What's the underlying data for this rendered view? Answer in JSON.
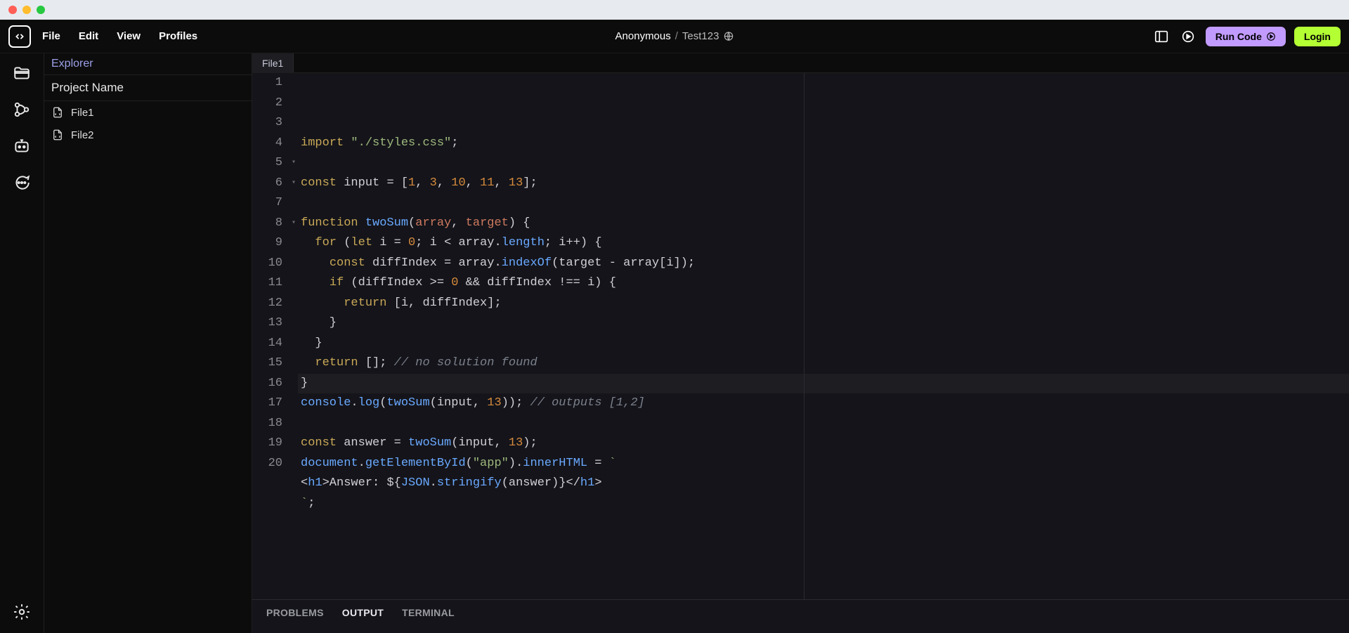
{
  "menu": {
    "file": "File",
    "edit": "Edit",
    "view": "View",
    "profiles": "Profiles"
  },
  "breadcrumb": {
    "owner": "Anonymous",
    "slash": "/",
    "project": "Test123"
  },
  "actions": {
    "run_code": "Run Code",
    "login": "Login"
  },
  "explorer": {
    "title": "Explorer",
    "project_name": "Project Name",
    "files": [
      "File1",
      "File2"
    ]
  },
  "tabs": {
    "active": "File1"
  },
  "bottom_tabs": {
    "problems": "PROBLEMS",
    "output": "OUTPUT",
    "terminal": "TERMINAL"
  },
  "gutter_count": 20,
  "code_lines": [
    [
      [
        "kw",
        "import"
      ],
      [
        "punct",
        " "
      ],
      [
        "str",
        "\"./styles.css\""
      ],
      [
        "punct",
        ";"
      ]
    ],
    [],
    [
      [
        "kw",
        "const"
      ],
      [
        "punct",
        " input "
      ],
      [
        "punct",
        "= ["
      ],
      [
        "num",
        "1"
      ],
      [
        "punct",
        ", "
      ],
      [
        "num",
        "3"
      ],
      [
        "punct",
        ", "
      ],
      [
        "num",
        "10"
      ],
      [
        "punct",
        ", "
      ],
      [
        "num",
        "11"
      ],
      [
        "punct",
        ", "
      ],
      [
        "num",
        "13"
      ],
      [
        "punct",
        "];"
      ]
    ],
    [],
    [
      [
        "kw",
        "function"
      ],
      [
        "punct",
        " "
      ],
      [
        "fn",
        "twoSum"
      ],
      [
        "punct",
        "("
      ],
      [
        "param",
        "array"
      ],
      [
        "punct",
        ", "
      ],
      [
        "param",
        "target"
      ],
      [
        "punct",
        ") {"
      ]
    ],
    [
      [
        "punct",
        "  "
      ],
      [
        "kw",
        "for"
      ],
      [
        "punct",
        " ("
      ],
      [
        "kw",
        "let"
      ],
      [
        "punct",
        " i "
      ],
      [
        "punct",
        "= "
      ],
      [
        "num",
        "0"
      ],
      [
        "punct",
        "; i "
      ],
      [
        "punct",
        "< "
      ],
      [
        "punct",
        "array."
      ],
      [
        "prop",
        "length"
      ],
      [
        "punct",
        "; i++) {"
      ]
    ],
    [
      [
        "punct",
        "    "
      ],
      [
        "kw",
        "const"
      ],
      [
        "punct",
        " diffIndex "
      ],
      [
        "punct",
        "= array."
      ],
      [
        "fn",
        "indexOf"
      ],
      [
        "punct",
        "(target "
      ],
      [
        "punct",
        "- array[i]);"
      ]
    ],
    [
      [
        "punct",
        "    "
      ],
      [
        "kw",
        "if"
      ],
      [
        "punct",
        " (diffIndex "
      ],
      [
        "punct",
        ">= "
      ],
      [
        "num",
        "0"
      ],
      [
        "punct",
        " "
      ],
      [
        "punct",
        "&& diffIndex "
      ],
      [
        "punct",
        "!== i) {"
      ]
    ],
    [
      [
        "punct",
        "      "
      ],
      [
        "kw",
        "return"
      ],
      [
        "punct",
        " [i, diffIndex];"
      ]
    ],
    [
      [
        "punct",
        "    }"
      ]
    ],
    [
      [
        "punct",
        "  }"
      ]
    ],
    [
      [
        "punct",
        "  "
      ],
      [
        "kw",
        "return"
      ],
      [
        "punct",
        " []; "
      ],
      [
        "cmt",
        "// no solution found"
      ]
    ],
    [
      [
        "punct",
        "}"
      ]
    ],
    [
      [
        "builtin",
        "console"
      ],
      [
        "punct",
        "."
      ],
      [
        "fn",
        "log"
      ],
      [
        "punct",
        "("
      ],
      [
        "fn",
        "twoSum"
      ],
      [
        "punct",
        "(input, "
      ],
      [
        "num",
        "13"
      ],
      [
        "punct",
        ")); "
      ],
      [
        "cmt",
        "// outputs [1,2]"
      ]
    ],
    [],
    [
      [
        "kw",
        "const"
      ],
      [
        "punct",
        " answer "
      ],
      [
        "punct",
        "= "
      ],
      [
        "fn",
        "twoSum"
      ],
      [
        "punct",
        "(input, "
      ],
      [
        "num",
        "13"
      ],
      [
        "punct",
        ");"
      ]
    ],
    [
      [
        "builtin",
        "document"
      ],
      [
        "punct",
        "."
      ],
      [
        "fn",
        "getElementById"
      ],
      [
        "punct",
        "("
      ],
      [
        "str",
        "\"app\""
      ],
      [
        "punct",
        ")."
      ],
      [
        "prop",
        "innerHTML"
      ],
      [
        "punct",
        " = "
      ],
      [
        "str",
        "`"
      ]
    ],
    [
      [
        "punct",
        "<"
      ],
      [
        "fn",
        "h1"
      ],
      [
        "punct",
        ">Answer: "
      ],
      [
        "punct",
        "${"
      ],
      [
        "builtin",
        "JSON"
      ],
      [
        "punct",
        "."
      ],
      [
        "fn",
        "stringify"
      ],
      [
        "punct",
        "(answer)"
      ],
      [
        "punct",
        "}"
      ],
      [
        "punct",
        "</"
      ],
      [
        "fn",
        "h1"
      ],
      [
        "punct",
        ">"
      ]
    ],
    [
      [
        "str",
        "`"
      ],
      [
        "punct",
        ";"
      ]
    ],
    []
  ],
  "fold_markers": {
    "5": "▾",
    "6": "▾",
    "8": "▾"
  },
  "highlight_line": 13
}
